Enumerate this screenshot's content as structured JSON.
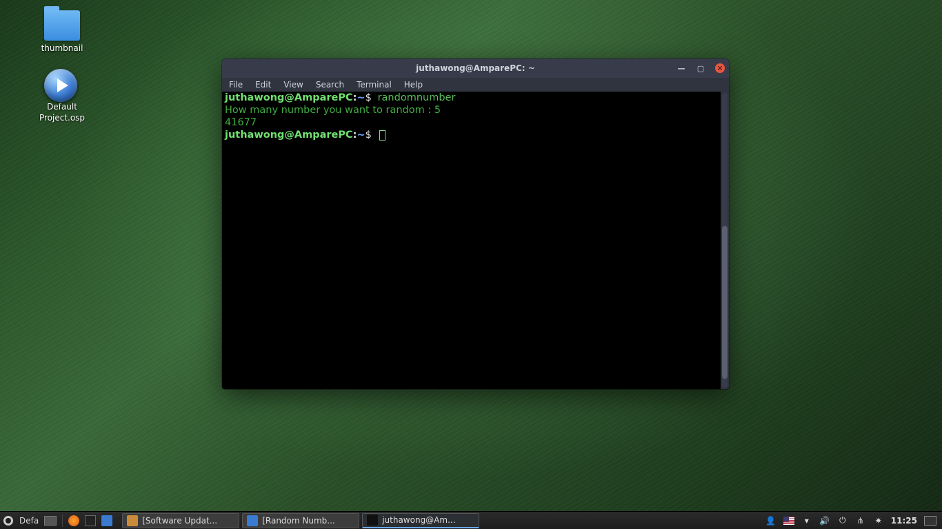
{
  "desktop": {
    "icons": [
      {
        "label": "thumbnail"
      },
      {
        "label": "Default Project.osp"
      }
    ]
  },
  "terminal": {
    "title": "juthawong@AmparePC: ~",
    "menus": [
      "File",
      "Edit",
      "View",
      "Search",
      "Terminal",
      "Help"
    ],
    "prompt": {
      "user": "juthawong@AmparePC",
      "sep": ":",
      "path": "~",
      "dollar": "$"
    },
    "cmd1": "randomnumber",
    "out1": "How many number you want to random : 5",
    "out2": "41677"
  },
  "win_controls": {
    "min": "—",
    "max": "▢",
    "close": "✕"
  },
  "taskbar": {
    "menu_label": "Defa",
    "tasks": [
      {
        "label": "[Software Updat...",
        "icon_bg": "#c98b3a"
      },
      {
        "label": "[Random Numb...",
        "icon_bg": "#3a7ad0"
      },
      {
        "label": "juthawong@Am...",
        "icon_bg": "#111",
        "active": true
      }
    ],
    "clock": "11:25"
  },
  "tray_icons": {
    "user": "👤",
    "wifi": "▾",
    "vol": "🔊",
    "power": "⏻",
    "bt": "⋔",
    "sun": "✷"
  }
}
